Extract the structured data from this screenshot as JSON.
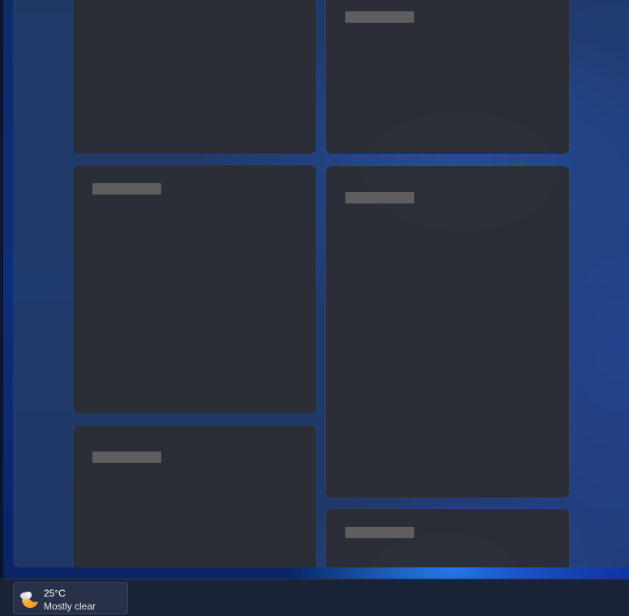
{
  "taskbar": {
    "weather": {
      "temperature": "25°C",
      "condition": "Mostly clear",
      "icon": "moon-cloud-icon"
    }
  },
  "widgets": {
    "cards": [
      {
        "state": "loading-placeholder"
      },
      {
        "state": "loading-placeholder"
      },
      {
        "state": "loading-placeholder"
      },
      {
        "state": "loading-placeholder"
      },
      {
        "state": "loading-placeholder"
      },
      {
        "state": "loading-placeholder"
      }
    ]
  },
  "colors": {
    "card_background": "#2c2e34",
    "placeholder_bar": "#5e5e60",
    "taskbar_background": "#1a2236",
    "accent_wallpaper": "#1e78ff"
  }
}
